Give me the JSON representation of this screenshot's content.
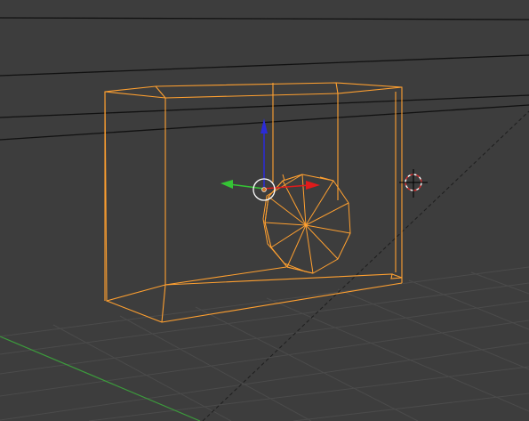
{
  "viewport": {
    "background": "#3d3d3d",
    "grid_color": "#4a4a4a",
    "x_axis_color": "#3c9b3c",
    "horizon_color": "#111111",
    "dashed_line_color": "#1e1e1e"
  },
  "selection": {
    "wire_color": "#ffa030",
    "objects": [
      "box-frame-wire",
      "wheel-wire"
    ]
  },
  "gizmo": {
    "z_axis_color": "#2b2bd8",
    "y_axis_color": "#35c435",
    "x_axis_color": "#e01b1b",
    "center_ring_color": "#ffffff",
    "origin_color": "#d07a30"
  },
  "cursor3d": {
    "icon": "3d-cursor-icon",
    "ring_colors": [
      "#ffffff",
      "#d83030"
    ]
  }
}
